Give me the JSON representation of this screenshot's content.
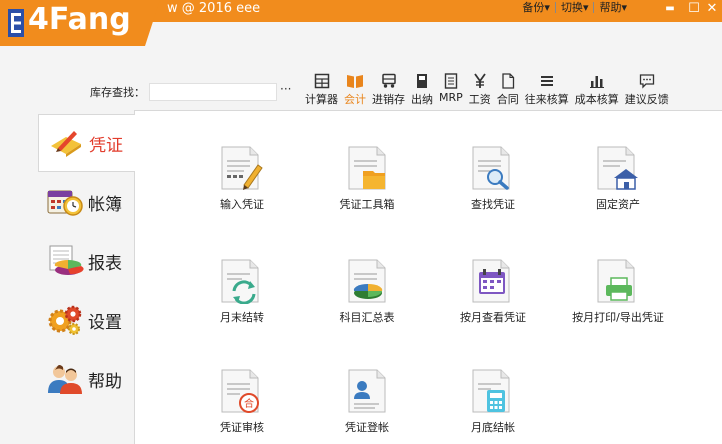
{
  "app": {
    "logo_text": "4Fang",
    "user_text": "w @ 2016 eee"
  },
  "top_menu": [
    {
      "label": "备份"
    },
    {
      "label": "切换"
    },
    {
      "label": "帮助"
    }
  ],
  "window_controls": {
    "minimize": "▬",
    "maximize": "☐",
    "close": "✕"
  },
  "search": {
    "label": "库存查找：",
    "value": "",
    "more": "···"
  },
  "toolbar": [
    {
      "label": "计算器",
      "icon": "calculator-icon"
    },
    {
      "label": "会计",
      "icon": "book-icon"
    },
    {
      "label": "进销存",
      "icon": "truck-icon"
    },
    {
      "label": "出纳",
      "icon": "binder-icon"
    },
    {
      "label": "MRP",
      "icon": "document-list-icon"
    },
    {
      "label": "工资",
      "icon": "yen-icon"
    },
    {
      "label": "合同",
      "icon": "contract-icon"
    },
    {
      "label": "往来核算",
      "icon": "menu-lines-icon"
    },
    {
      "label": "成本核算",
      "icon": "bar-chart-icon"
    },
    {
      "label": "建议反馈",
      "icon": "feedback-icon"
    }
  ],
  "sidebar": [
    {
      "label": "凭证",
      "icon": "voucher-pen-icon"
    },
    {
      "label": "帐簿",
      "icon": "calendar-clock-icon"
    },
    {
      "label": "报表",
      "icon": "report-pie-icon"
    },
    {
      "label": "设置",
      "icon": "gears-icon"
    },
    {
      "label": "帮助",
      "icon": "users-help-icon"
    }
  ],
  "functions": [
    {
      "label": "输入凭证",
      "icon": "input-voucher-icon"
    },
    {
      "label": "凭证工具箱",
      "icon": "voucher-toolbox-icon"
    },
    {
      "label": "查找凭证",
      "icon": "find-voucher-icon"
    },
    {
      "label": "固定资产",
      "icon": "fixed-asset-icon"
    },
    {
      "label": "月末结转",
      "icon": "month-end-transfer-icon"
    },
    {
      "label": "科目汇总表",
      "icon": "account-summary-icon"
    },
    {
      "label": "按月查看凭证",
      "icon": "monthly-view-icon"
    },
    {
      "label": "按月打印/导出凭证",
      "icon": "print-export-icon"
    },
    {
      "label": "凭证审核",
      "icon": "voucher-audit-icon"
    },
    {
      "label": "凭证登帐",
      "icon": "voucher-posting-icon"
    },
    {
      "label": "月底结帐",
      "icon": "month-close-icon"
    }
  ],
  "colors": {
    "brand": "#f18c1d",
    "active_nav": "#e23d2d",
    "accent": "#e9851c"
  }
}
